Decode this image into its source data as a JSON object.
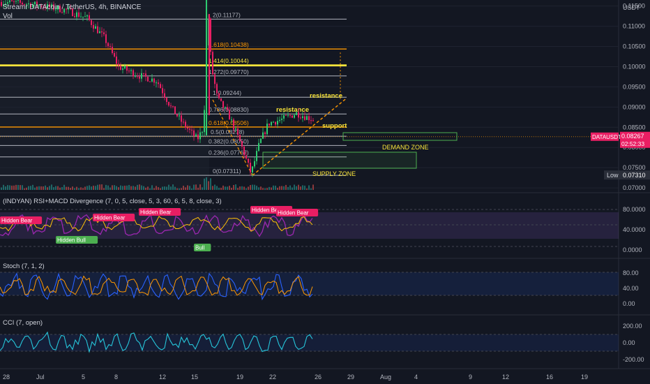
{
  "header": {
    "symbol_line": "Streamr DATAcoin / TetherUS, 4h, BINANCE",
    "vol_label": "Vol"
  },
  "price_axis": {
    "unit_label": "USDT",
    "ticks": [
      "0.11500",
      "0.11000",
      "0.10500",
      "0.10000",
      "0.09500",
      "0.09000",
      "0.08500",
      "0.08000",
      "0.07500",
      "0.07000"
    ],
    "symbol_badge": "DATAUSDT",
    "last_price": "0.08267",
    "countdown": "02:52:33",
    "low_label": "Low",
    "low_value": "0.07310"
  },
  "time_axis": {
    "ticks": [
      "28",
      "Jul",
      "5",
      "8",
      "12",
      "15",
      "19",
      "22",
      "26",
      "29",
      "Aug",
      "4",
      "9",
      "12",
      "16",
      "19"
    ]
  },
  "fib_levels": [
    {
      "label": "2(0.11177)",
      "price": 0.11177,
      "color": "#b2b5be"
    },
    {
      "label": "1.618(0.10438)",
      "price": 0.10438,
      "color": "#ff9800"
    },
    {
      "label": "1.414(0.10044)",
      "price": 0.10044,
      "color": "#f7e33a"
    },
    {
      "label": "1.272(0.09770)",
      "price": 0.0977,
      "color": "#b2b5be"
    },
    {
      "label": "1(0.09244)",
      "price": 0.09244,
      "color": "#b2b5be"
    },
    {
      "label": "0.786(0.08830)",
      "price": 0.0883,
      "color": "#b2b5be"
    },
    {
      "label": "0.618(0.08506)",
      "price": 0.08506,
      "color": "#ff9800"
    },
    {
      "label": "0.5(0.08278)",
      "price": 0.08278,
      "color": "#b2b5be"
    },
    {
      "label": "0.382(0.08050)",
      "price": 0.0805,
      "color": "#b2b5be"
    },
    {
      "label": "0.236(0.07767)",
      "price": 0.07767,
      "color": "#b2b5be"
    },
    {
      "label": "0(0.07311)",
      "price": 0.07311,
      "color": "#b2b5be"
    }
  ],
  "annotations": {
    "resistance_upper": "resistance",
    "resistance_lower": "resistance",
    "support": "support",
    "demand_zone": "DEMAND ZONE",
    "supply_zone": "SUPPLY ZONE"
  },
  "panes": {
    "rsi": {
      "title": "(INDYAN) RSI+MACD Divergence (7, 0, 5, close, 5, 3, 60, 6, 5, 8, close, 3)",
      "ticks": [
        "80.0000",
        "40.0000",
        "0.0000"
      ],
      "labels": [
        "Hidden Bear",
        "Hidden Bear",
        "Hidden Bear",
        "Hidden Bear",
        "Hidden Bear",
        "Hidden Bull",
        "Bull"
      ]
    },
    "stoch": {
      "title": "Stoch (7, 1, 2)",
      "ticks": [
        "80.00",
        "40.00",
        "0.00"
      ]
    },
    "cci": {
      "title": "CCI (7, open)",
      "ticks": [
        "200.00",
        "0.00",
        "-200.00"
      ]
    }
  },
  "colors": {
    "background": "#131722",
    "up": "#26a69a",
    "down": "#ef5350",
    "candle_up": "#2ecc71",
    "candle_down": "#e91e63",
    "annot_yellow": "#f7e33a",
    "zone_green": "#4caf50",
    "rsi_line": "#9c27b0",
    "rsi_signal": "#ffc107",
    "stoch_k": "#2962ff",
    "stoch_d": "#ff9800",
    "cci": "#26c6da"
  },
  "chart_data": {
    "type": "candlestick",
    "title": "Streamr DATAcoin / TetherUS, 4h, BINANCE",
    "ylim": [
      0.0695,
      0.1165
    ],
    "x_ticks": [
      "28",
      "Jul",
      "5",
      "8",
      "12",
      "15",
      "19",
      "22",
      "26",
      "29",
      "Aug",
      "4",
      "9",
      "12",
      "16",
      "19"
    ],
    "waypoints": [
      {
        "x": 0,
        "p": 0.116
      },
      {
        "x": 45,
        "p": 0.1155
      },
      {
        "x": 95,
        "p": 0.114
      },
      {
        "x": 125,
        "p": 0.112
      },
      {
        "x": 150,
        "p": 0.107
      },
      {
        "x": 170,
        "p": 0.1
      },
      {
        "x": 200,
        "p": 0.0978
      },
      {
        "x": 225,
        "p": 0.0965
      },
      {
        "x": 245,
        "p": 0.09
      },
      {
        "x": 262,
        "p": 0.086
      },
      {
        "x": 283,
        "p": 0.082
      },
      {
        "x": 292,
        "p": 0.085
      },
      {
        "x": 298,
        "p": 0.115
      },
      {
        "x": 303,
        "p": 0.1
      },
      {
        "x": 312,
        "p": 0.092
      },
      {
        "x": 328,
        "p": 0.088
      },
      {
        "x": 345,
        "p": 0.081
      },
      {
        "x": 360,
        "p": 0.0735
      },
      {
        "x": 372,
        "p": 0.081
      },
      {
        "x": 385,
        "p": 0.086
      },
      {
        "x": 405,
        "p": 0.087
      },
      {
        "x": 425,
        "p": 0.0885
      },
      {
        "x": 440,
        "p": 0.0875
      },
      {
        "x": 450,
        "p": 0.087
      }
    ]
  }
}
